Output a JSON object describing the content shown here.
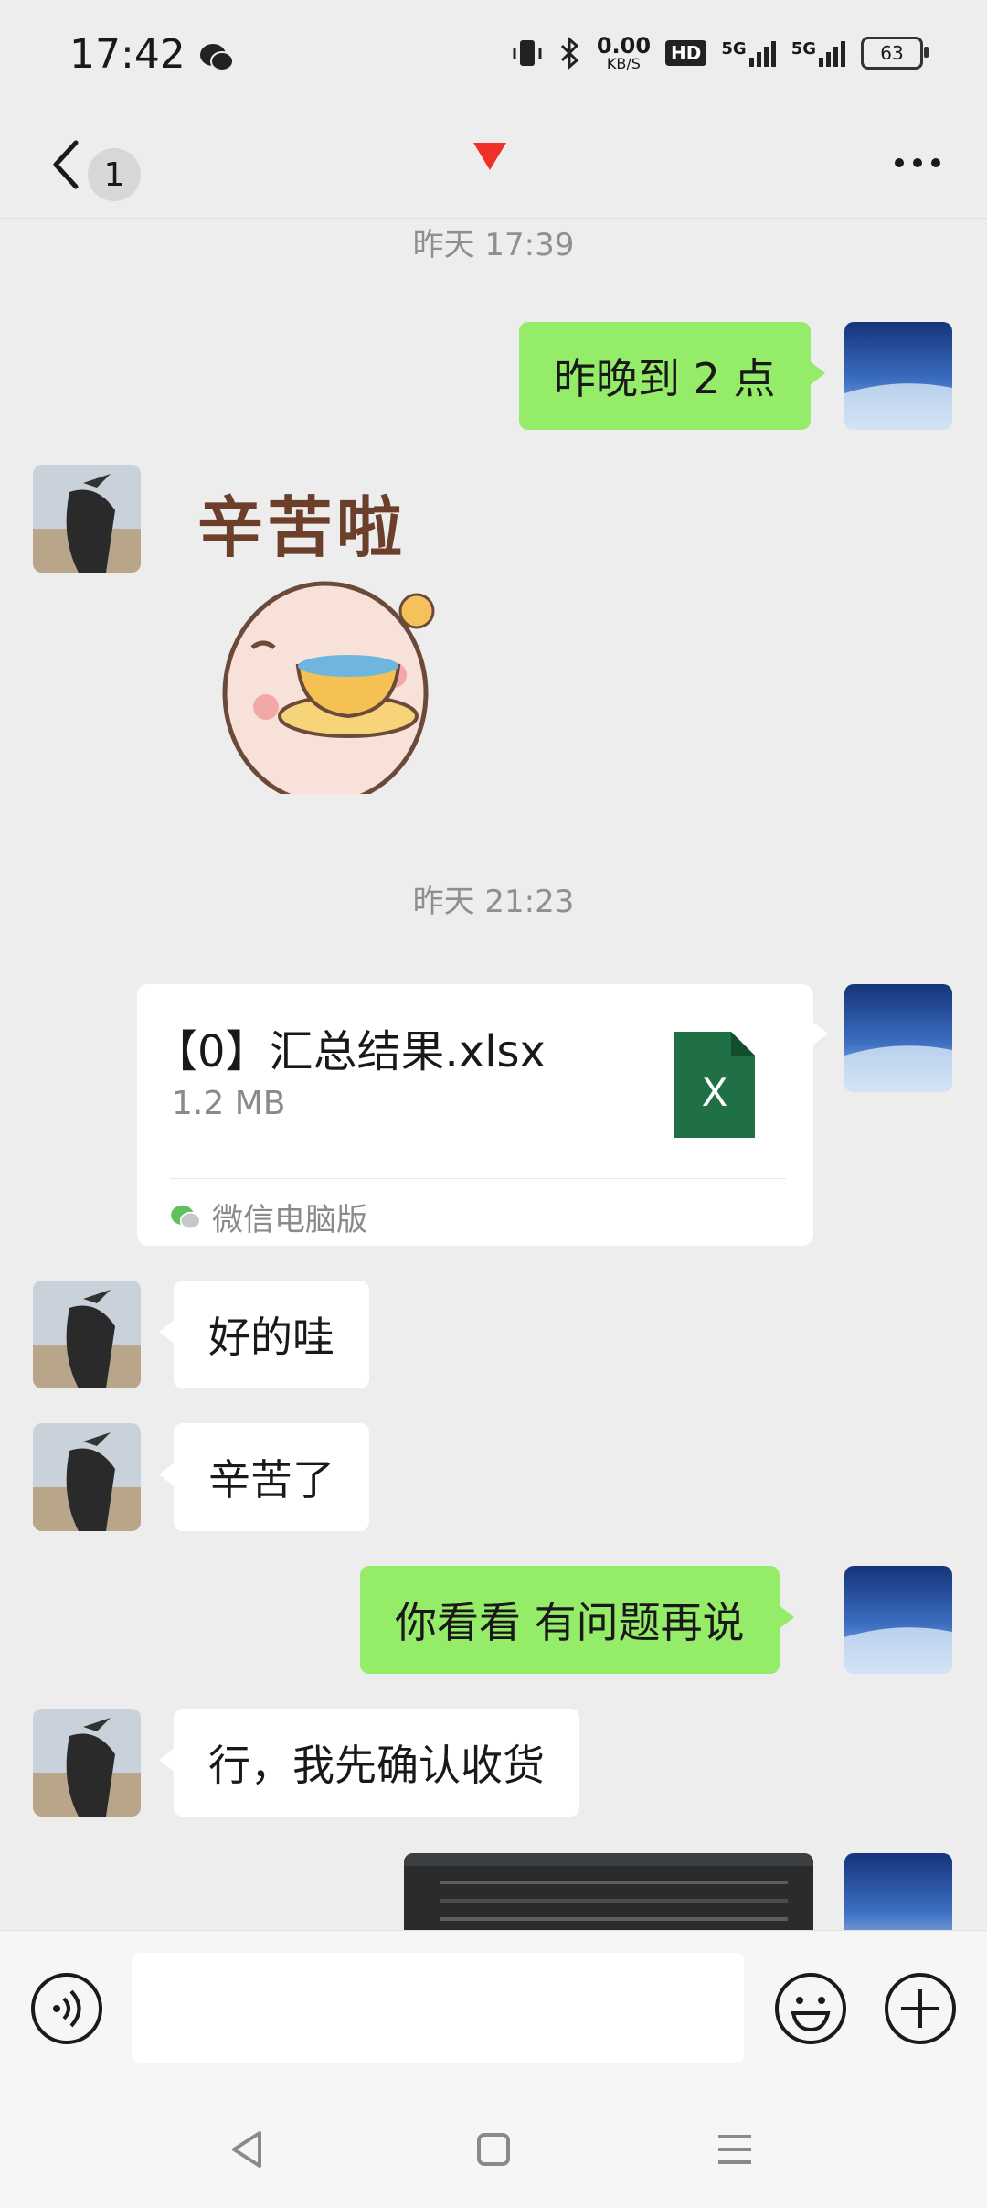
{
  "status_bar": {
    "time": "17:42",
    "net_speed_value": "0.00",
    "net_speed_unit": "KB/S",
    "hd_label": "HD",
    "signal_1": "5G",
    "signal_2": "5G",
    "battery": "63"
  },
  "title_bar": {
    "unread_count": "1"
  },
  "messages": {
    "time_1": "昨天 17:39",
    "msg_1": "昨晚到 2 点",
    "sticker_text": "辛苦啦",
    "time_2": "昨天 21:23",
    "file_name": "【0】汇总结果.xlsx",
    "file_size": "1.2 MB",
    "file_source": "微信电脑版",
    "file_icon_letter": "X",
    "msg_2": "好的哇",
    "msg_3": "辛苦了",
    "msg_4": "你看看 有问题再说",
    "msg_5": "行，我先确认收货"
  },
  "input_bar": {
    "value": ""
  },
  "colors": {
    "sent_bubble": "#95ec69",
    "received_bubble": "#ffffff",
    "background": "#ededed",
    "excel_green": "#1f7145"
  },
  "icons": [
    "wechat-icon",
    "vibrate-icon",
    "bluetooth-icon",
    "back-chevron-icon",
    "red-triangle-icon",
    "more-icon",
    "excel-file-icon",
    "voice-icon",
    "emoji-icon",
    "add-icon",
    "nav-back-icon",
    "nav-home-icon",
    "nav-menu-icon"
  ]
}
